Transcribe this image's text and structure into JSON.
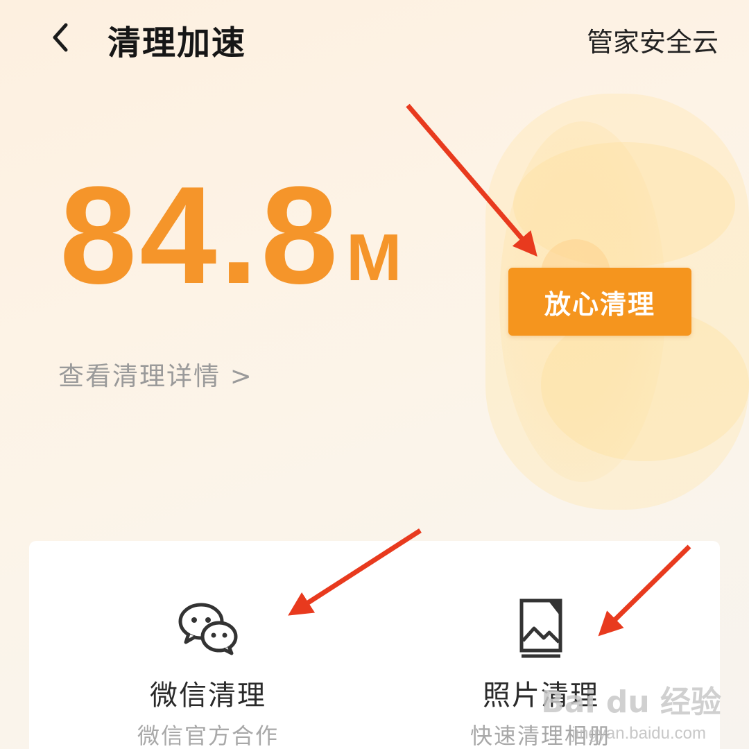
{
  "header": {
    "title": "清理加速",
    "right_link": "管家安全云"
  },
  "scan": {
    "size_value": "84.8",
    "size_unit": "M",
    "details_link": "查看清理详情 >"
  },
  "primary_action": {
    "label": "放心清理"
  },
  "tools": [
    {
      "title": "微信清理",
      "subtitle": "微信官方合作",
      "icon": "wechat-icon"
    },
    {
      "title": "照片清理",
      "subtitle": "快速清理相册",
      "icon": "photo-album-icon"
    }
  ],
  "watermark": {
    "brand": "Bai du 经验",
    "url": "jingyan.baidu.com"
  },
  "colors": {
    "accent": "#f5952a",
    "button": "#f5951e",
    "annotation": "#e83a1e"
  }
}
